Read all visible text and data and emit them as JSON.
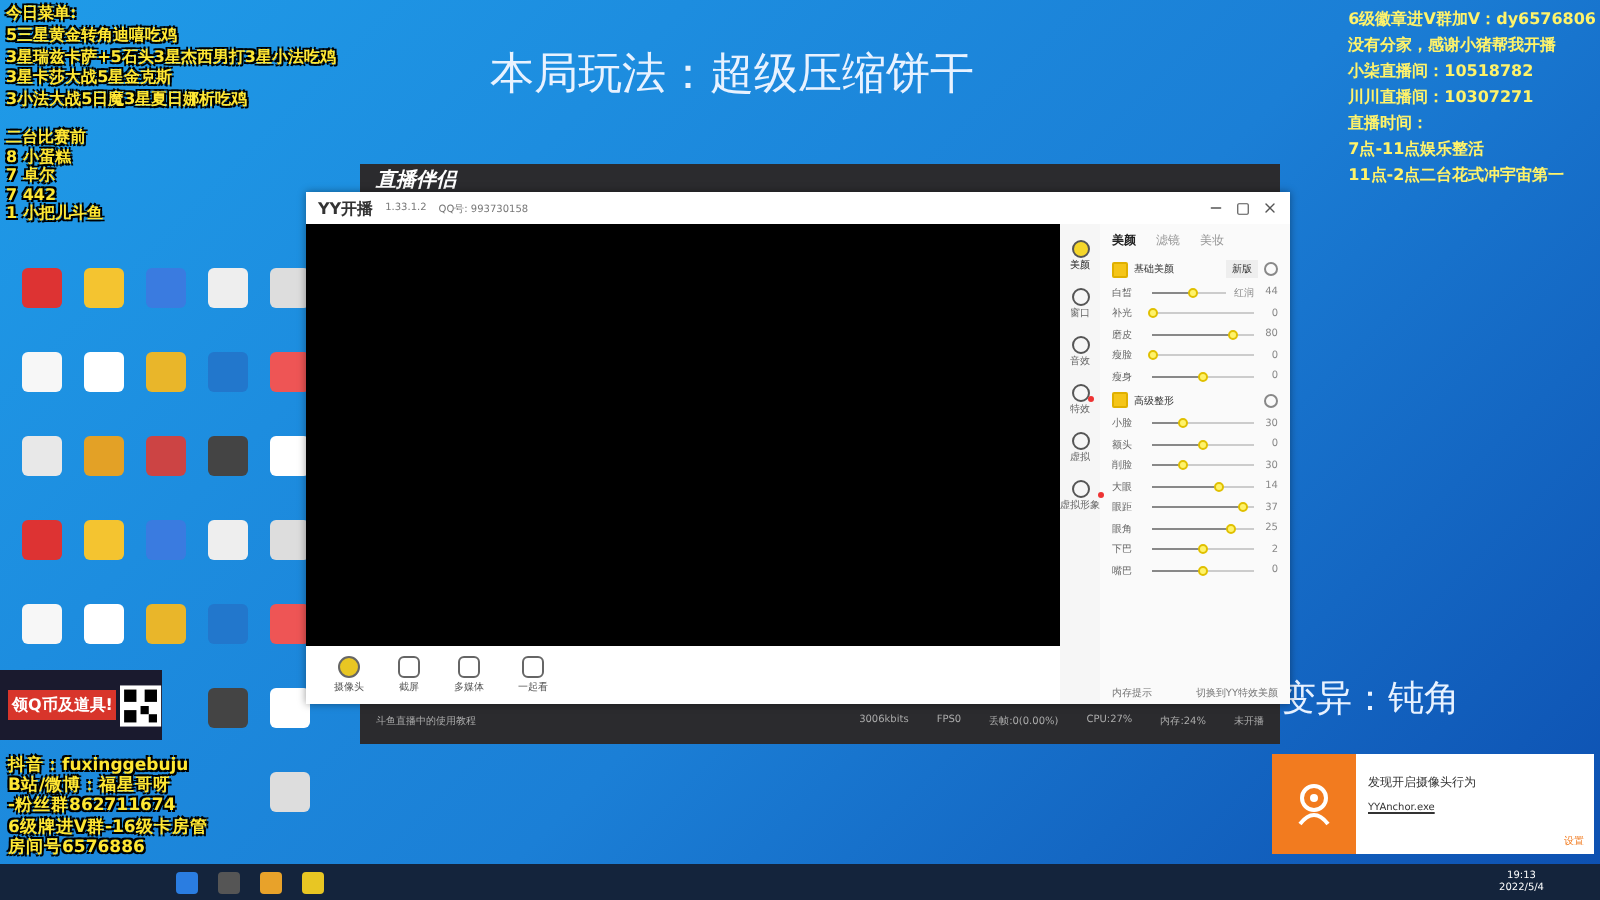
{
  "overlay_left_top": [
    "今日菜单:",
    "5三星黄金转角迪嘻吃鸡",
    "3星瑞兹卡萨+5石头3星杰西男打3星小法吃鸡",
    "3星卡莎大战5星金克斯",
    "3小法大战5日魔3星夏日娜析吃鸡"
  ],
  "overlay_left_list": [
    "二台比赛前",
    "8 小蛋糕",
    "7 卓尔",
    "7 442",
    "1 小把儿斗鱼"
  ],
  "overlay_right_top": [
    "6级徽章进V群加V：dy6576806",
    "没有分家，感谢小猪帮我开播",
    "小柒直播间：10518782",
    "川川直播间：10307271",
    "直播时间：",
    "7点-11点娱乐整活",
    "11点-2点二台花式冲宇宙第一"
  ],
  "game_mode": "本局玩法：超级压缩饼干",
  "mutation": "变异：钝角",
  "ad_banner": "领Q币及道具!",
  "overlay_bottom_left": [
    "抖音：fuxinggebuju",
    "B站/微博：福星哥呀",
    "-粉丝群862711674",
    "6级牌进V群-16级卡房管",
    "房间号6576886"
  ],
  "companion_window": {
    "title": "直播伴侣"
  },
  "yy_window": {
    "title": "YY开播",
    "version": "1.33.1.2",
    "qq": "QQ号: 993730158",
    "side_tabs": [
      {
        "label": "美颜",
        "selected": true,
        "dot": false
      },
      {
        "label": "窗口",
        "selected": false,
        "dot": false
      },
      {
        "label": "音效",
        "selected": false,
        "dot": false
      },
      {
        "label": "特效",
        "selected": false,
        "dot": true
      },
      {
        "label": "虚拟",
        "selected": false,
        "dot": false
      },
      {
        "label": "虚拟形象",
        "selected": false,
        "dot": true
      }
    ],
    "top_tabs": [
      {
        "label": "美颜",
        "selected": true
      },
      {
        "label": "滤镜",
        "selected": false
      },
      {
        "label": "美妆",
        "selected": false
      }
    ],
    "sections": [
      {
        "title": "基础美颜",
        "checked": true,
        "dropdown": "新版",
        "sliders": [
          {
            "name": "白皙",
            "extra": "红润",
            "level": 0.55,
            "reading": "44"
          },
          {
            "name": "补光",
            "level": 0,
            "reading": "0"
          },
          {
            "name": "磨皮",
            "level": 0.8,
            "reading": "80"
          },
          {
            "name": "瘦脸",
            "level": 0,
            "reading": "0"
          },
          {
            "name": "瘦身",
            "level": 0.5,
            "reading": "0"
          }
        ]
      },
      {
        "title": "高级整形",
        "checked": true,
        "sliders": [
          {
            "name": "小脸",
            "level": 0.3,
            "reading": "30"
          },
          {
            "name": "额头",
            "level": 0.5,
            "reading": "0"
          },
          {
            "name": "削脸",
            "level": 0.3,
            "reading": "30"
          },
          {
            "name": "大眼",
            "level": 0.65,
            "reading": "14"
          },
          {
            "name": "眼距",
            "level": 0.9,
            "reading": "37"
          },
          {
            "name": "眼角",
            "level": 0.78,
            "reading": "25"
          },
          {
            "name": "下巴",
            "level": 0.5,
            "reading": "2"
          },
          {
            "name": "嘴巴",
            "level": 0.5,
            "reading": "0"
          }
        ]
      }
    ],
    "footer": [
      "内存提示",
      "切换到YY特效美颜"
    ],
    "tools": [
      {
        "label": "摄像头",
        "selected": true
      },
      {
        "label": "截屏",
        "selected": false
      },
      {
        "label": "多媒体",
        "selected": false
      },
      {
        "label": "一起看",
        "selected": false
      }
    ]
  },
  "status_bar": [
    "斗鱼直播中的使用教程",
    "3006kbits",
    "FPS0",
    "丢帧:0(0.00%)",
    "CPU:27%",
    "内存:24%",
    "未开播"
  ],
  "notification": {
    "title": "发现开启摄像头行为",
    "app": "YYAnchor.exe",
    "action": "设置"
  },
  "taskbar": {
    "time": "19:13",
    "date": "2022/5/4"
  }
}
